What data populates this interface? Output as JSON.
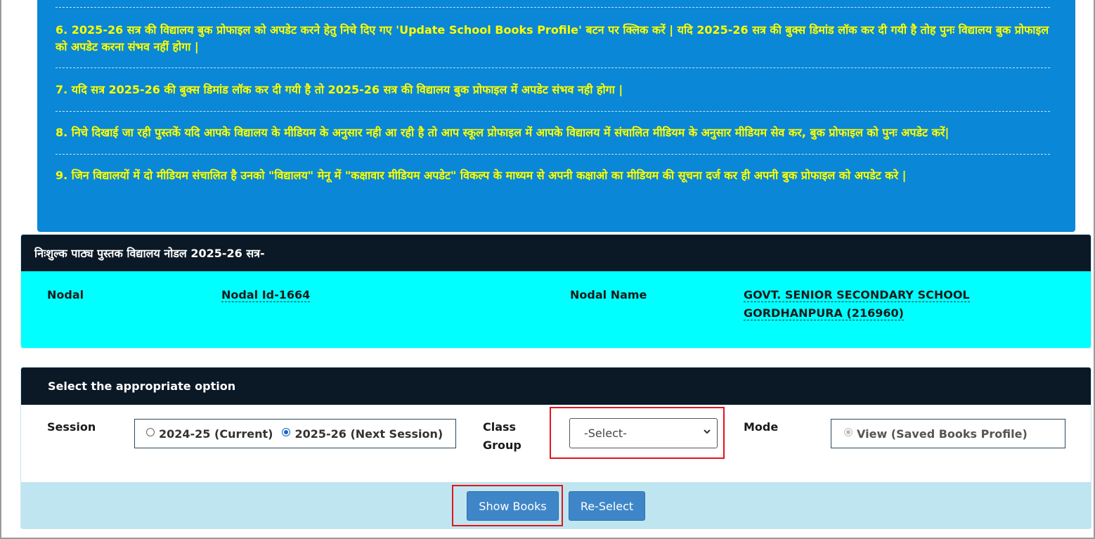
{
  "notice": {
    "items": [
      "6. 2025-26 सत्र की विद्यालय बुक प्रोफाइल को अपडेट करने हेतु निचे दिए गए 'Update School Books Profile' बटन पर क्लिक करें | यदि 2025-26 सत्र की बुक्स डिमांड लॉक कर दी गयी है तोह पुनः विद्यालय बुक प्रोफाइल को अपडेट करना संभव नहीं होगा |",
      "7. यदि सत्र 2025-26 की बुक्स डिमांड लॉक कर दी गयी है तो 2025-26 सत्र की विद्यालय बुक प्रोफाइल में अपडेट संभव नही होगा |",
      "8. निचे दिखाई जा रही पुस्तकें यदि आपके विद्यालय के मीडियम के अनुसार नही आ रही है तो आप स्कूल प्रोफाइल में आपके विद्यालय में संचालित मीडियम के अनुसार मीडियम सेव कर, बुक प्रोफाइल को पुनः अपडेट करें|",
      "9. जिन विद्यालयों में दो मीडियम संचालित है उनको \"विद्यालय\" मेनू में \"कक्षावार मीडियम अपडेट\" विकल्प के माध्यम से अपनी कक्षाओ का मीडियम की सूचना दर्ज कर ही अपनी बुक प्रोफाइल को अपडेट करे |"
    ]
  },
  "nodal_panel": {
    "title": "निःशुल्क पाठ्य पुस्तक विद्यालय नोडल 2025-26 सत्र-",
    "nodal_label": "Nodal",
    "nodal_id": "Nodal Id-1664",
    "nodal_name_label": "Nodal Name",
    "nodal_name_line1": "GOVT. SENIOR SECONDARY SCHOOL",
    "nodal_name_line2": "GORDHANPURA (216960)"
  },
  "options_panel": {
    "title": "Select the appropriate option",
    "session_label": "Session",
    "session_options": [
      "2024-25 (Current)",
      "2025-26 (Next Session)"
    ],
    "session_selected": "2025-26 (Next Session)",
    "class_group_label_1": "Class",
    "class_group_label_2": "Group",
    "class_group_value": "-Select-",
    "mode_label": "Mode",
    "mode_option": "View (Saved Books Profile)"
  },
  "buttons": {
    "show_books": "Show Books",
    "reselect": "Re-Select"
  },
  "colors": {
    "notice_bg": "#0a87d6",
    "notice_text": "#ffff00",
    "panel_head": "#0b1826",
    "nodal_bg": "#00ffff",
    "footer_bg": "#bfe6f0",
    "button": "#3f86c8",
    "highlight": "#e3141c"
  }
}
